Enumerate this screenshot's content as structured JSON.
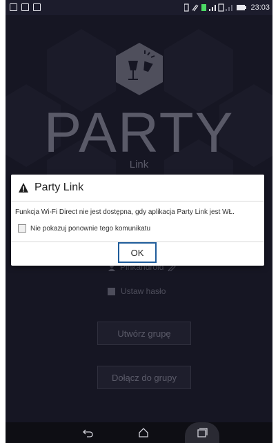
{
  "status_bar": {
    "time": "23:03"
  },
  "background": {
    "app_title": "PARTY",
    "app_subtitle": "Link",
    "username": "Pinkandroid",
    "password_label": "Ustaw hasło",
    "create_group_label": "Utwórz grupę",
    "join_group_label": "Dołącz do grupy"
  },
  "dialog": {
    "title": "Party Link",
    "message": "Funkcja Wi-Fi Direct nie jest dostępna, gdy aplikacja Party Link jest WŁ.",
    "checkbox_label": "Nie pokazuj ponownie tego komunikatu",
    "checkbox_checked": false,
    "ok_label": "OK"
  },
  "colors": {
    "accent_border": "#1f5c9a",
    "background": "#232336"
  }
}
